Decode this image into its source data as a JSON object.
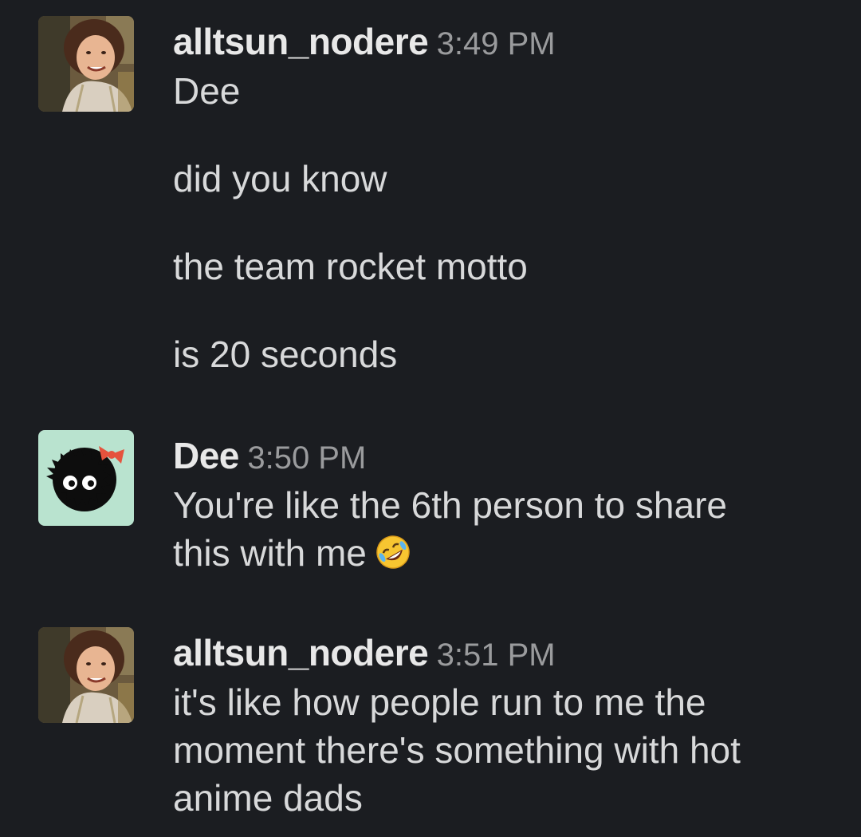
{
  "messages": [
    {
      "username": "alltsun_nodere",
      "timestamp": "3:49 PM",
      "avatar_icon": "user-photo-avatar",
      "lines": [
        "Dee",
        "did you know",
        "the team rocket motto",
        "is 20 seconds"
      ]
    },
    {
      "username": "Dee",
      "timestamp": "3:50 PM",
      "avatar_icon": "soot-sprite-avatar",
      "lines": [
        "You're like the 6th person to share",
        "this with me"
      ],
      "emoji": "rolling-on-floor-laughing-emoji"
    },
    {
      "username": "alltsun_nodere",
      "timestamp": "3:51 PM",
      "avatar_icon": "user-photo-avatar",
      "lines": [
        "it's like how people run to me the",
        "moment there's something with hot",
        "anime dads"
      ]
    }
  ],
  "colors": {
    "background": "#1b1d21",
    "username": "#e8e8e8",
    "timestamp": "#9a9b9d",
    "text": "#d8d9da",
    "soot_avatar_bg": "#b9e3cf",
    "bow": "#e5533d"
  }
}
